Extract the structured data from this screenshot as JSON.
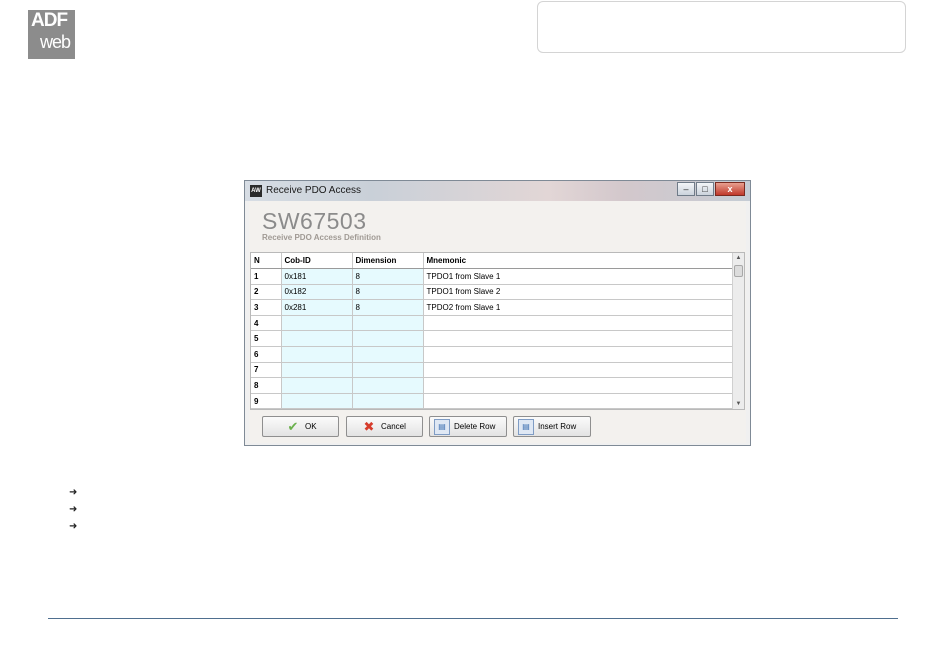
{
  "logo": {
    "line1": "ADF",
    "line2": "web"
  },
  "dialog": {
    "window_title": "Receive PDO Access",
    "app_icon_text": "AW",
    "product": "SW67503",
    "subtitle": "Receive PDO Access Definition",
    "window_controls": {
      "minimize": "–",
      "maximize": "□",
      "close": "x"
    },
    "grid": {
      "columns": [
        "N",
        "Cob-ID",
        "Dimension",
        "Mnemonic"
      ],
      "rows": [
        {
          "n": "1",
          "cob_id": "0x181",
          "dimension": "8",
          "mnemonic": "TPDO1 from Slave 1"
        },
        {
          "n": "2",
          "cob_id": "0x182",
          "dimension": "8",
          "mnemonic": "TPDO1 from Slave 2"
        },
        {
          "n": "3",
          "cob_id": "0x281",
          "dimension": "8",
          "mnemonic": "TPDO2 from Slave 1"
        },
        {
          "n": "4",
          "cob_id": "",
          "dimension": "",
          "mnemonic": ""
        },
        {
          "n": "5",
          "cob_id": "",
          "dimension": "",
          "mnemonic": ""
        },
        {
          "n": "6",
          "cob_id": "",
          "dimension": "",
          "mnemonic": ""
        },
        {
          "n": "7",
          "cob_id": "",
          "dimension": "",
          "mnemonic": ""
        },
        {
          "n": "8",
          "cob_id": "",
          "dimension": "",
          "mnemonic": ""
        },
        {
          "n": "9",
          "cob_id": "",
          "dimension": "",
          "mnemonic": ""
        }
      ]
    },
    "buttons": {
      "ok": "OK",
      "cancel": "Cancel",
      "delete_row": "Delete Row",
      "insert_row": "Insert Row"
    }
  },
  "icons": {
    "ok": "checkmark-icon",
    "cancel": "red-x-icon",
    "delete_row": "delete-row-icon",
    "insert_row": "insert-row-icon",
    "bullet": "arrow-bullet-icon"
  },
  "colors": {
    "logo_bg": "#8c8c8c",
    "cyan_cell": "#e6fafe",
    "footer_line": "#4f6f8f"
  }
}
